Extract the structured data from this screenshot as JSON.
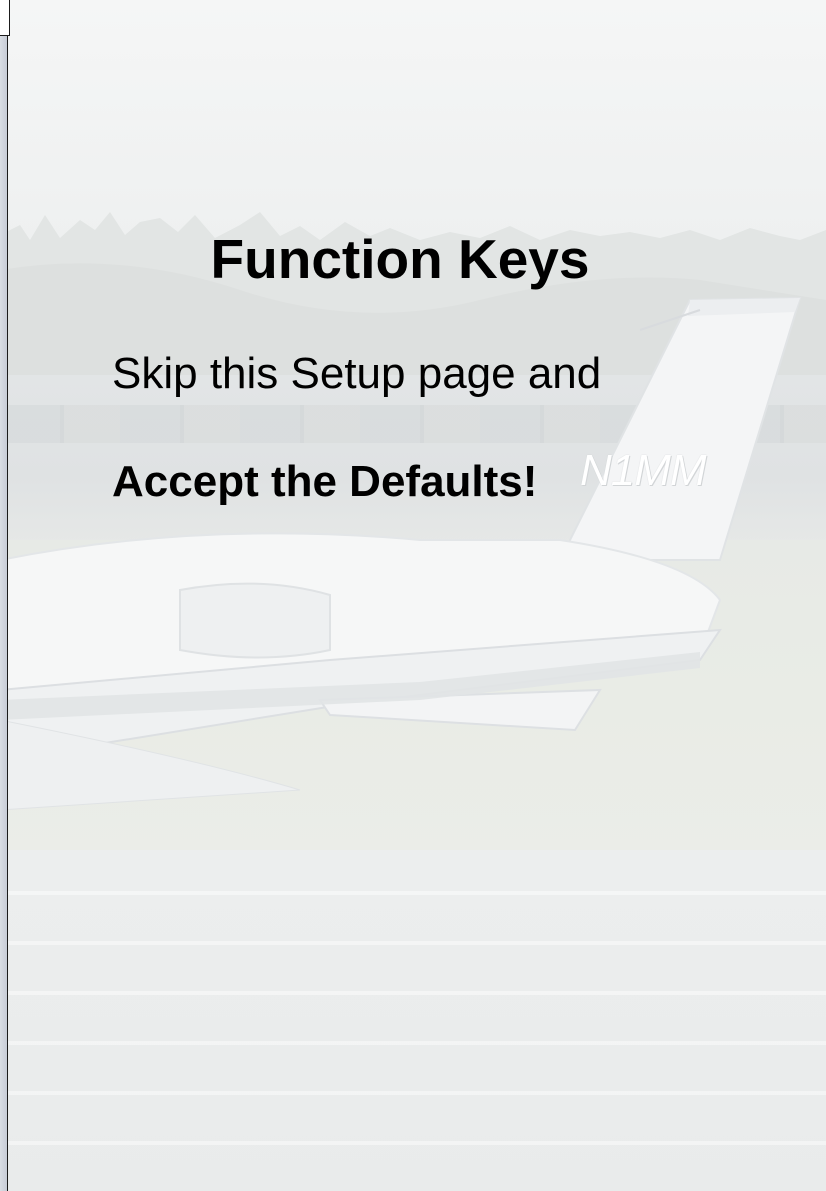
{
  "slide": {
    "title": "Function Keys",
    "line_1": "Skip this Setup page and",
    "line_2": "Accept the Defaults!"
  },
  "background": {
    "tail_registration": "N1MM"
  }
}
